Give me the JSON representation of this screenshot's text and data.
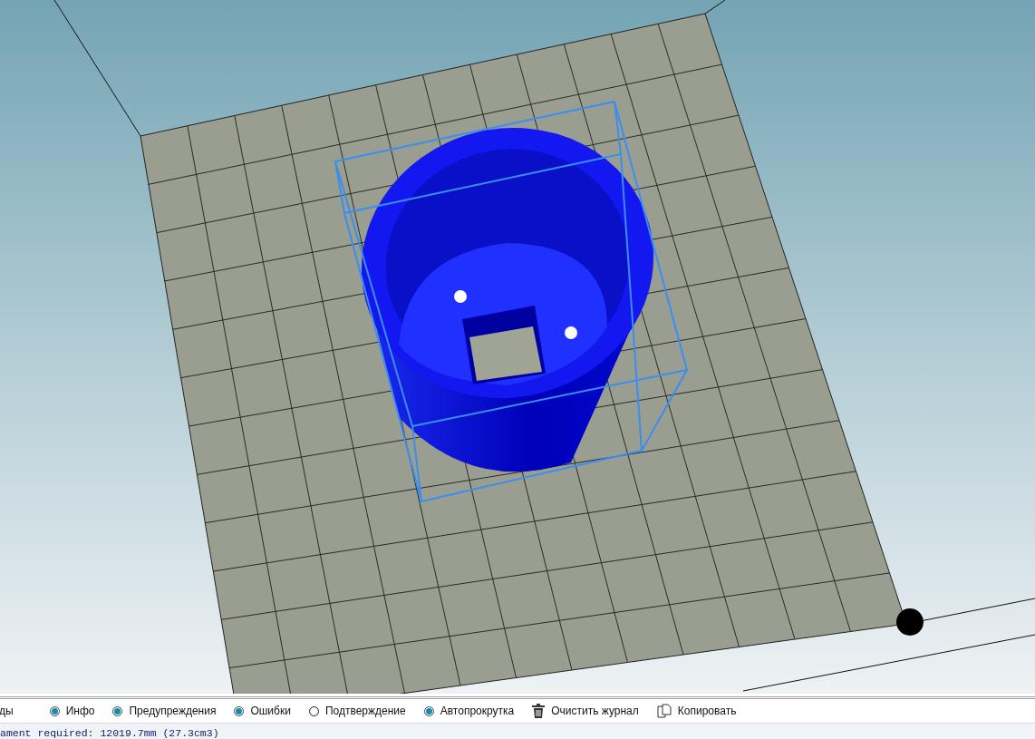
{
  "toolbar": [
    {
      "kind": "text",
      "label": "ды"
    },
    {
      "kind": "radio",
      "label": "Инфо",
      "checked": true
    },
    {
      "kind": "radio",
      "label": "Предупреждения",
      "checked": true
    },
    {
      "kind": "radio",
      "label": "Ошибки",
      "checked": true
    },
    {
      "kind": "radio",
      "label": "Подтверждение",
      "checked": false
    },
    {
      "kind": "radio",
      "label": "Автопрокрутка",
      "checked": true
    },
    {
      "kind": "trash",
      "label": "Очистить журнал"
    },
    {
      "kind": "copy",
      "label": "Копировать"
    }
  ],
  "log": {
    "line": "ament required: 12019.7mm (27.3cm3)"
  }
}
